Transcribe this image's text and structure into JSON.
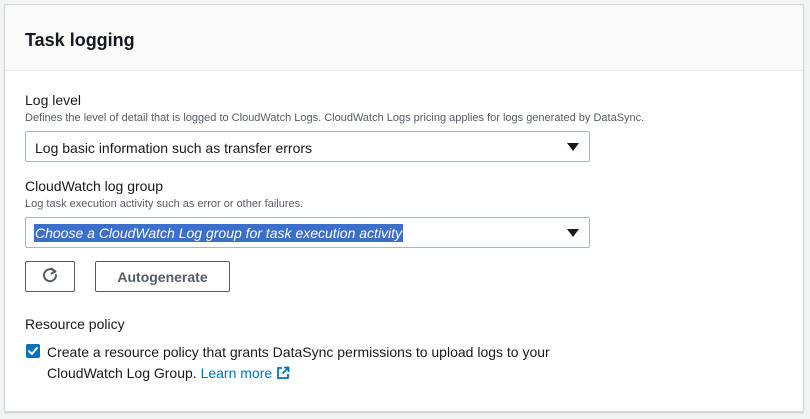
{
  "panel": {
    "title": "Task logging"
  },
  "log_level": {
    "label": "Log level",
    "description": "Defines the level of detail that is logged to CloudWatch Logs. CloudWatch Logs pricing applies for logs generated by DataSync.",
    "selected": "Log basic information such as transfer errors"
  },
  "log_group": {
    "label": "CloudWatch log group",
    "description": "Log task execution activity such as error or other failures.",
    "placeholder": "Choose a CloudWatch Log group for task execution activity"
  },
  "buttons": {
    "refresh_icon": "refresh-icon",
    "autogenerate": "Autogenerate"
  },
  "resource_policy": {
    "label": "Resource policy",
    "checked": true,
    "text_line1": "Create a resource policy that grants DataSync permissions to upload logs to your",
    "text_line2": "CloudWatch Log Group.",
    "link": "Learn more",
    "link_icon": "external-link-icon"
  },
  "colors": {
    "accent": "#0073bb",
    "selection": "#3b6fc9",
    "border": "#aab7b8"
  }
}
